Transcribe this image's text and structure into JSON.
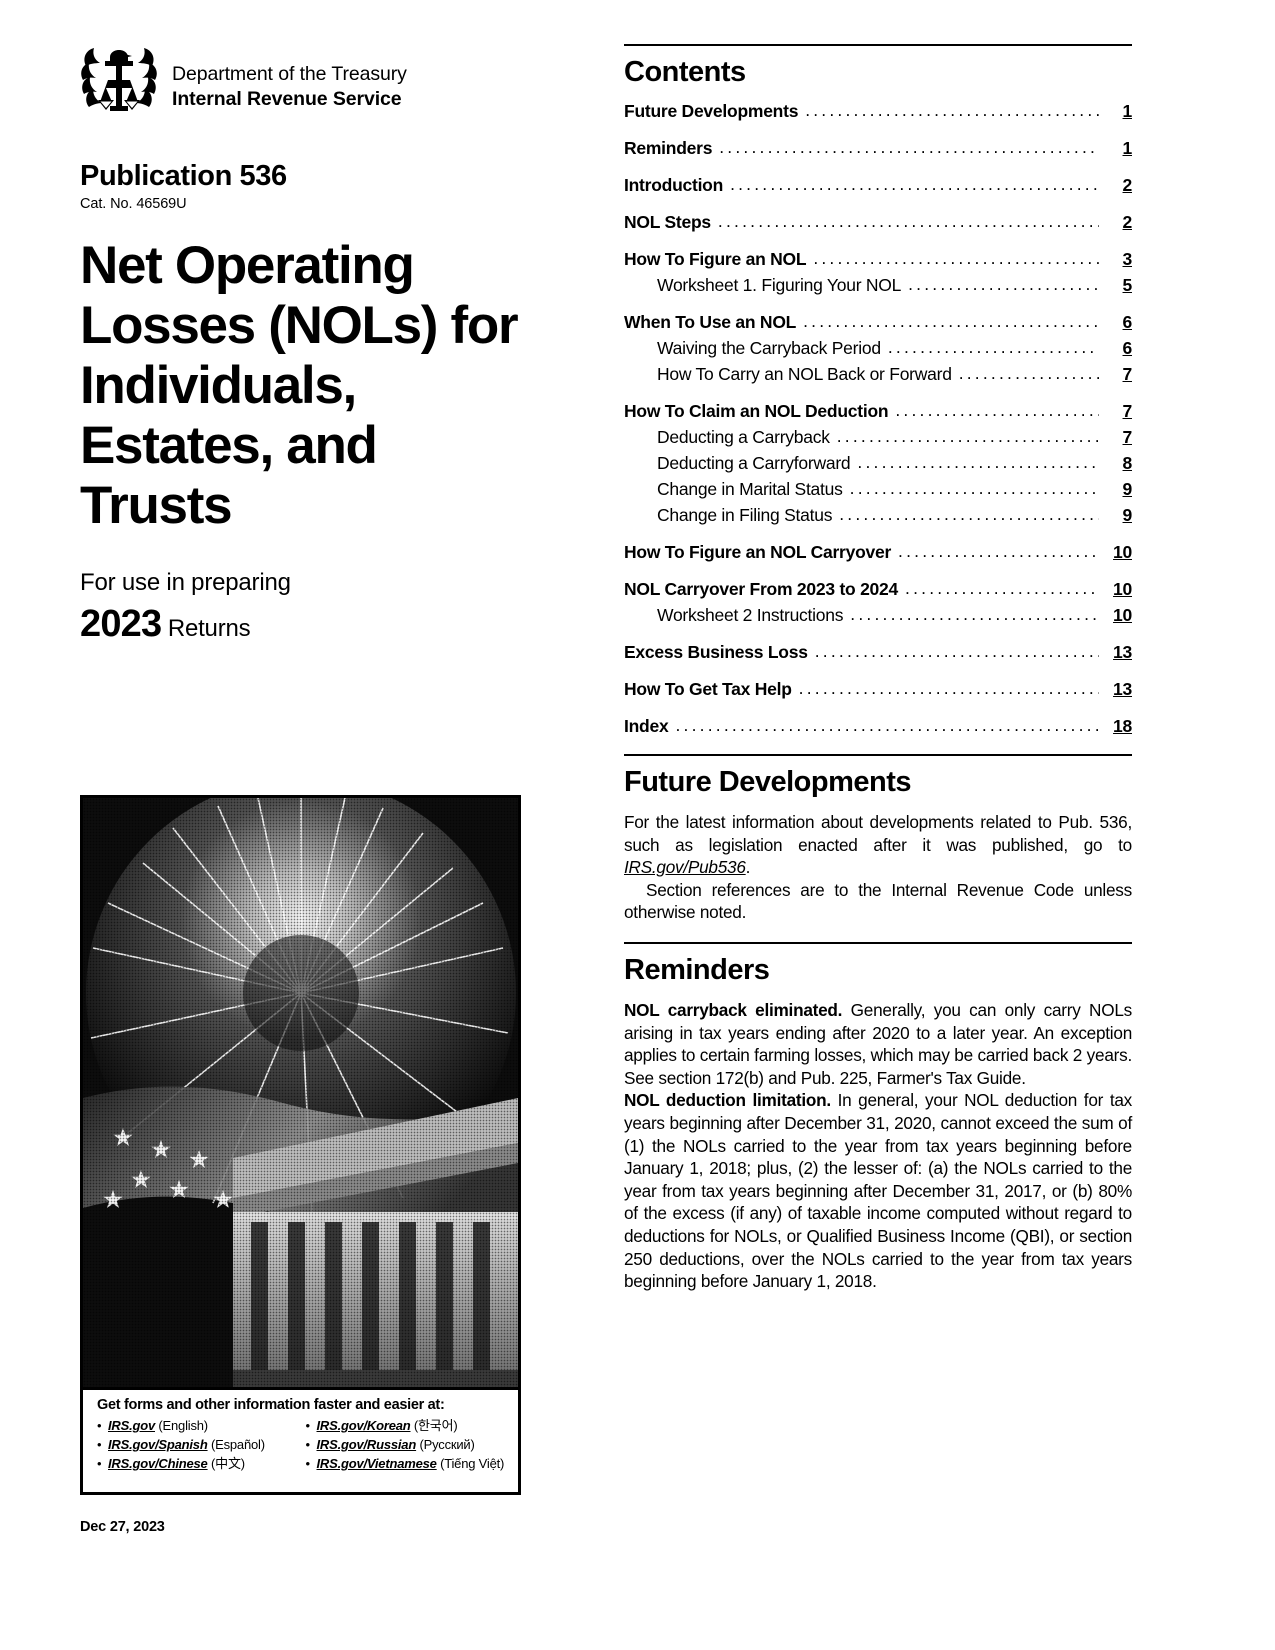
{
  "masthead": {
    "department": "Department of the Treasury",
    "agency": "Internal Revenue Service",
    "seal_icon": "irs-eagle-scales-seal"
  },
  "publication": {
    "number": "Publication 536",
    "cat_no": "Cat. No. 46569U",
    "title": "Net Operating Losses (NOLs) for Individuals, Estates, and Trusts",
    "for_use_label": "For use in preparing",
    "year": "2023",
    "returns_label": "Returns"
  },
  "cover_image": {
    "alt": "fireworks-over-us-capitol-with-flag-and-eagle",
    "info_box": {
      "heading": "Get forms and other information faster and easier at:",
      "languages_left": [
        {
          "url": "IRS.gov",
          "label": "(English)"
        },
        {
          "url": "IRS.gov/Spanish",
          "label": "(Español)"
        },
        {
          "url": "IRS.gov/Chinese",
          "label": "(中文)"
        }
      ],
      "languages_right": [
        {
          "url": "IRS.gov/Korean",
          "label": "(한국어)"
        },
        {
          "url": "IRS.gov/Russian",
          "label": "(Pусский)"
        },
        {
          "url": "IRS.gov/Vietnamese",
          "label": "(Tiếng Việt)"
        }
      ]
    }
  },
  "footer": {
    "date": "Dec 27, 2023"
  },
  "contents": {
    "heading": "Contents",
    "entries": [
      {
        "label": "Future Developments",
        "page": "1",
        "level": "major"
      },
      {
        "label": "Reminders",
        "page": "1",
        "level": "major"
      },
      {
        "label": "Introduction",
        "page": "2",
        "level": "major"
      },
      {
        "label": "NOL Steps",
        "page": "2",
        "level": "major"
      },
      {
        "label": "How To Figure an NOL",
        "page": "3",
        "level": "major"
      },
      {
        "label": "Worksheet 1. Figuring Your NOL",
        "page": "5",
        "level": "sub"
      },
      {
        "label": "When To Use an NOL",
        "page": "6",
        "level": "major"
      },
      {
        "label": "Waiving the Carryback Period",
        "page": "6",
        "level": "sub"
      },
      {
        "label": "How To Carry an NOL Back or Forward",
        "page": "7",
        "level": "sub"
      },
      {
        "label": "How To Claim an NOL Deduction",
        "page": "7",
        "level": "major"
      },
      {
        "label": "Deducting a Carryback",
        "page": "7",
        "level": "sub"
      },
      {
        "label": "Deducting a Carryforward",
        "page": "8",
        "level": "sub"
      },
      {
        "label": "Change in Marital Status",
        "page": "9",
        "level": "sub"
      },
      {
        "label": "Change in Filing Status",
        "page": "9",
        "level": "sub"
      },
      {
        "label": "How To Figure an NOL Carryover",
        "page": "10",
        "level": "major"
      },
      {
        "label": "NOL Carryover From 2023 to 2024",
        "page": "10",
        "level": "major"
      },
      {
        "label": "Worksheet 2 Instructions",
        "page": "10",
        "level": "sub"
      },
      {
        "label": "Excess Business Loss",
        "page": "13",
        "level": "major"
      },
      {
        "label": "How To Get Tax Help",
        "page": "13",
        "level": "major"
      },
      {
        "label": "Index",
        "page": "18",
        "level": "major"
      }
    ]
  },
  "future_developments": {
    "heading": "Future Developments",
    "para1_before_link": "For the latest information about developments related to Pub. 536, such as legislation enacted after it was published, go to ",
    "link": "IRS.gov/Pub536",
    "para1_after_link": ".",
    "para2": "Section references are to the Internal Revenue Code unless otherwise noted."
  },
  "reminders": {
    "heading": "Reminders",
    "items": [
      {
        "run_in": "NOL carryback eliminated.",
        "text": " Generally, you can only carry NOLs arising in tax years ending after 2020 to a later year. An exception applies to certain farming losses, which may be carried back 2 years. See section 172(b) and Pub. 225, Farmer's Tax Guide."
      },
      {
        "run_in": "NOL deduction limitation.",
        "text": " In general, your NOL deduction for tax years beginning after December 31, 2020, cannot exceed the sum of (1) the NOLs carried to the year from tax years beginning before January 1, 2018; plus, (2) the lesser of: (a) the NOLs carried to the year from tax years beginning after December 31, 2017, or (b) 80% of the excess (if any) of taxable income computed without regard to deductions for NOLs, or Qualified Business Income (QBI), or section 250 deductions, over the NOLs carried to the year from tax years beginning before January 1, 2018."
      }
    ]
  }
}
